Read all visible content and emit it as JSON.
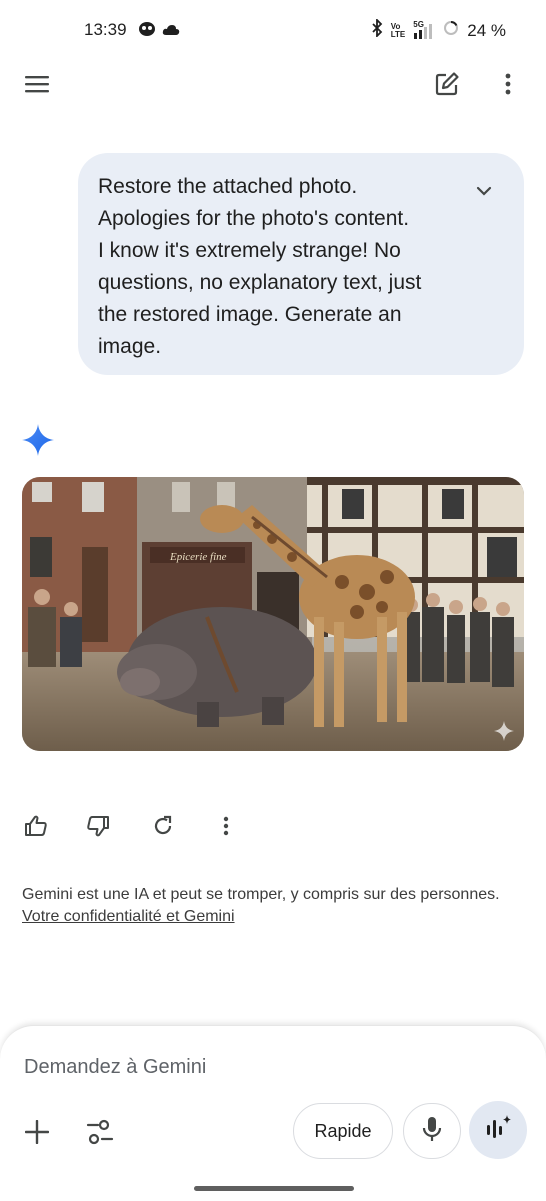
{
  "status_bar": {
    "time": "13:39",
    "net_label_top": "Vo",
    "net_label_bottom": "LTE",
    "gen": "5G",
    "battery": "24 %",
    "icons": [
      "cat-notification-icon",
      "cloud-icon",
      "bluetooth-icon",
      "signal-icon",
      "battery-ring-icon"
    ]
  },
  "top_bar": {
    "icons": [
      "menu-icon",
      "new-chat-icon",
      "more-vert-icon"
    ]
  },
  "user_message": {
    "text": "Restore the attached photo.\nApologies for the photo's content.\nI know it's extremely strange! No\nquestions, no explanatory text, just\nthe restored image. Generate an\nimage."
  },
  "response": {
    "image_alt": "Vintage photo of a giraffe and a hippopotamus harnessed in a town square in front of the Epicerie shop, with townspeople watching",
    "shop_sign": "Epicerie fine",
    "action_icons": [
      "thumb-up-icon",
      "thumb-down-icon",
      "redo-icon",
      "more-vert-icon"
    ]
  },
  "disclaimer": {
    "text": "Gemini est une IA et peut se tromper, y compris sur des personnes.",
    "link": "Votre confidentialité et Gemini"
  },
  "composer": {
    "placeholder": "Demandez à Gemini",
    "model_label": "Rapide",
    "icons": [
      "plus-icon",
      "tools-icon",
      "mic-icon",
      "live-icon"
    ]
  },
  "colors": {
    "bubble": "#e9eef6",
    "sparkle": "#4285f4",
    "live_button": "#e2e8f2"
  }
}
